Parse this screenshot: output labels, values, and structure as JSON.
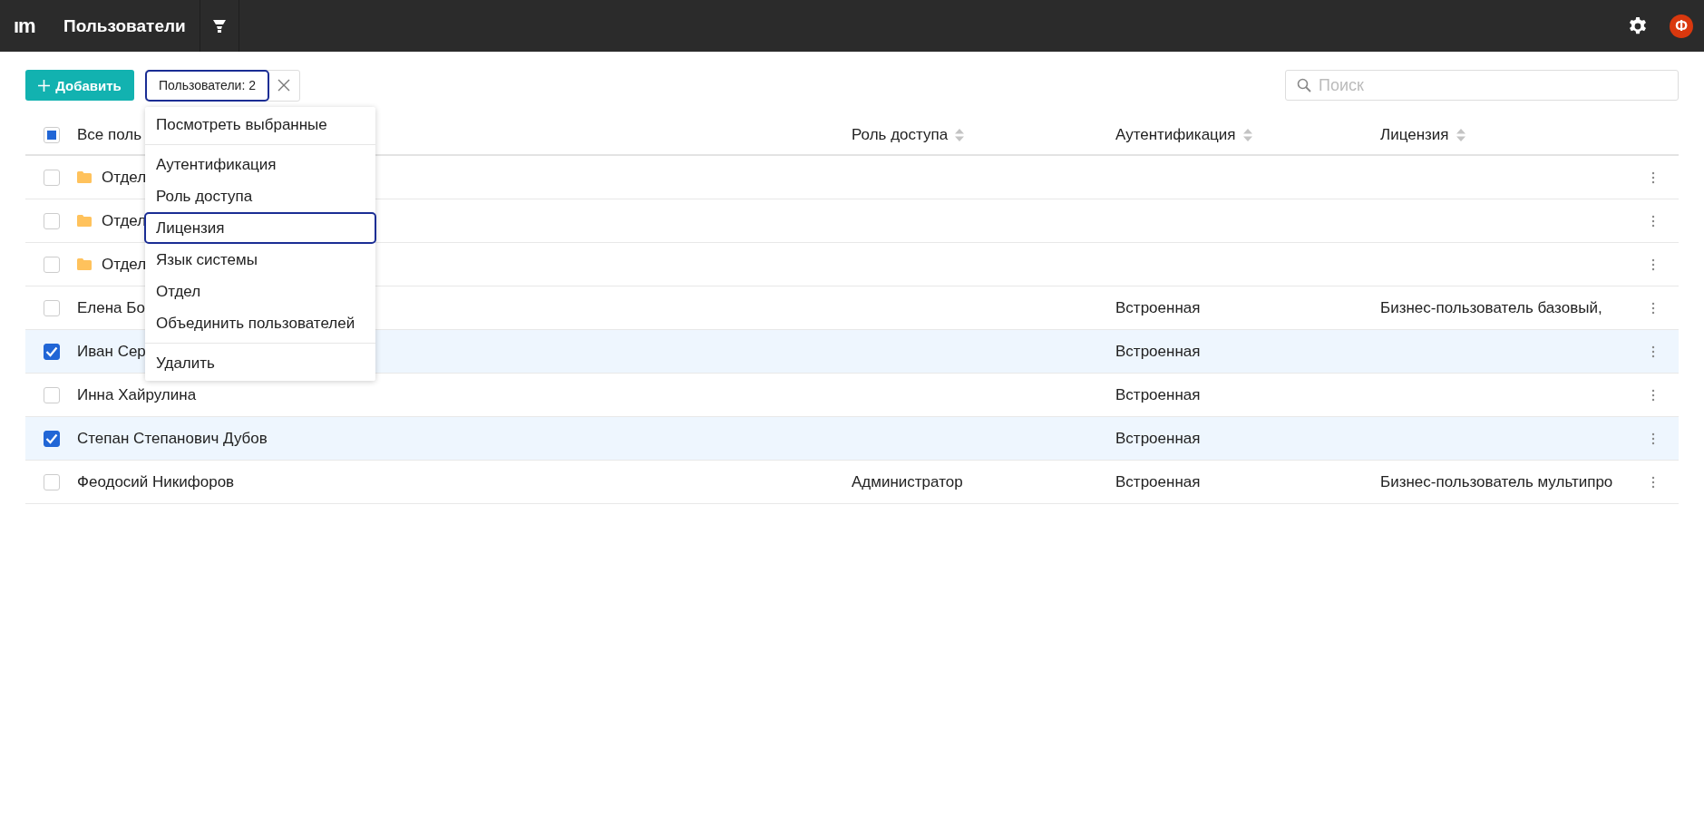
{
  "app": {
    "logo": "ım",
    "title": "Пользователи",
    "avatar": "Ф"
  },
  "toolbar": {
    "add_button": "Добавить",
    "selection_chip": {
      "label": "Пользователи: 2",
      "focused": true
    },
    "search": {
      "placeholder": "Поиск"
    }
  },
  "table": {
    "select_all": {
      "partial": true
    },
    "columns": [
      {
        "label": "Все поль",
        "sortable": false
      },
      {
        "label": "Роль доступа",
        "sortable": true
      },
      {
        "label": "Аутентификация",
        "sortable": true
      },
      {
        "label": "Лицензия",
        "sortable": true
      }
    ],
    "rows": [
      {
        "kind": "folder",
        "checked": false,
        "name": "Отдел"
      },
      {
        "kind": "folder",
        "checked": false,
        "name": "Отдел"
      },
      {
        "kind": "folder",
        "checked": false,
        "name": "Отдел"
      },
      {
        "kind": "user",
        "checked": false,
        "name": "Елена Бо",
        "auth": "Встроенная",
        "license": "Бизнес-пользователь базовый,"
      },
      {
        "kind": "user",
        "checked": true,
        "name": "Иван Сер",
        "auth": "Встроенная"
      },
      {
        "kind": "user",
        "checked": false,
        "name": "Инна Хайрулина",
        "auth": "Встроенная"
      },
      {
        "kind": "user",
        "checked": true,
        "name": "Степан Степанович Дубов",
        "auth": "Встроенная"
      },
      {
        "kind": "user",
        "checked": false,
        "name": "Феодосий Никифоров",
        "role": "Администратор",
        "auth": "Встроенная",
        "license": "Бизнес-пользователь мультипро"
      }
    ]
  },
  "menu": {
    "items": [
      {
        "label": "Посмотреть выбранные",
        "focused": false,
        "divider_after": true
      },
      {
        "label": "Аутентификация",
        "focused": false,
        "divider_after": false
      },
      {
        "label": "Роль доступа",
        "focused": false,
        "divider_after": false
      },
      {
        "label": "Лицензия",
        "focused": true,
        "divider_after": false
      },
      {
        "label": "Язык системы",
        "focused": false,
        "divider_after": false
      },
      {
        "label": "Отдел",
        "focused": false,
        "divider_after": false
      },
      {
        "label": "Объединить пользователей",
        "focused": false,
        "divider_after": true
      },
      {
        "label": "Удалить",
        "focused": false,
        "divider_after": false
      }
    ]
  }
}
